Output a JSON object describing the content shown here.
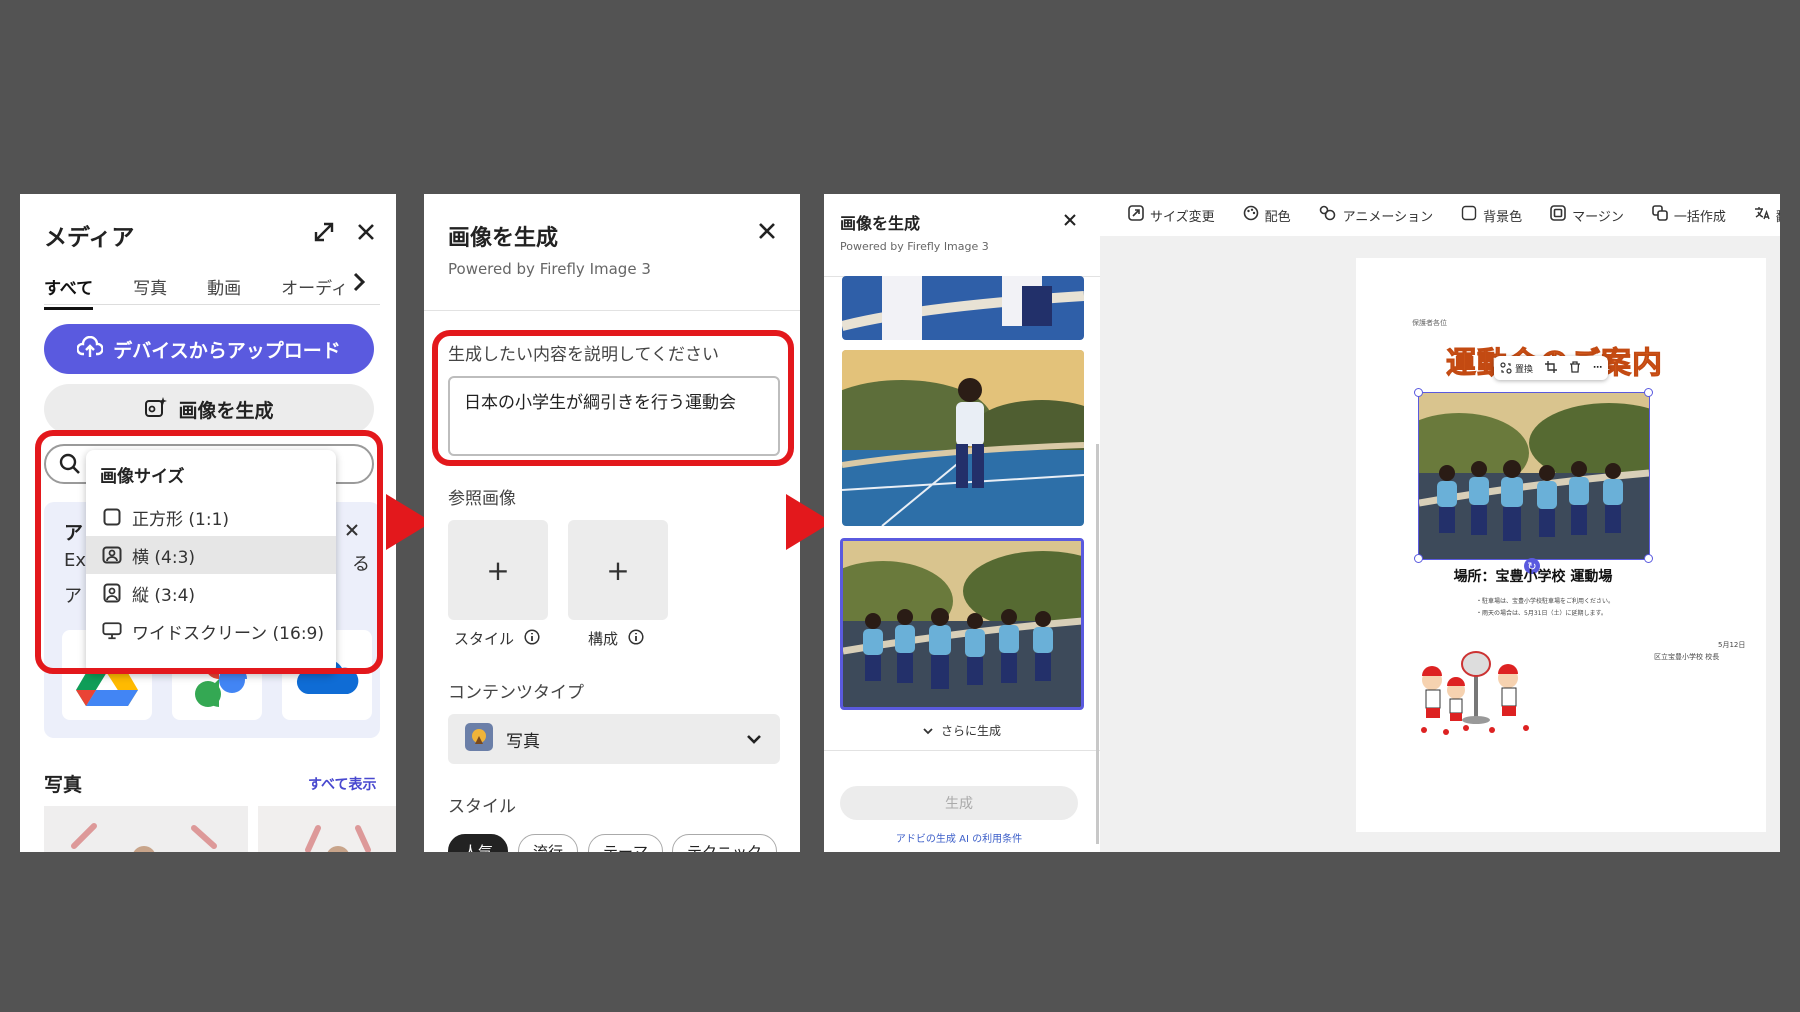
{
  "panel_media": {
    "title": "メディア",
    "tabs": [
      "すべて",
      "写真",
      "動画",
      "オーディ"
    ],
    "upload_label": "デバイスからアップロード",
    "generate_label": "画像を生成",
    "promo_fragments": [
      "ア",
      "Ex",
      "ア",
      "る"
    ],
    "dropdown": {
      "title": "画像サイズ",
      "items": [
        {
          "label": "正方形 (1:1)",
          "icon": "square-icon"
        },
        {
          "label": "横 (4:3)",
          "icon": "landscape-portrait-icon",
          "selected": true
        },
        {
          "label": "縦 (3:4)",
          "icon": "portrait-icon"
        },
        {
          "label": "ワイドスクリーン (16:9)",
          "icon": "monitor-icon"
        }
      ]
    },
    "photos_heading": "写真",
    "show_all": "すべて表示"
  },
  "panel_generate": {
    "title": "画像を生成",
    "powered_by": "Powered by Firefly Image 3",
    "prompt_label": "生成したい内容を説明してください",
    "prompt_value": "日本の小学生が綱引きを行う運動会",
    "reference_heading": "参照画像",
    "ref_style_label": "スタイル",
    "ref_composition_label": "構成",
    "content_type_heading": "コンテンツタイプ",
    "content_type_value": "写真",
    "style_heading": "スタイル",
    "style_chips": [
      "人気",
      "流行",
      "テーマ",
      "テクニック"
    ]
  },
  "panel_results": {
    "title": "画像を生成",
    "powered_by": "Powered by Firefly Image 3",
    "more_label": "さらに生成",
    "generate_button": "生成",
    "terms_link": "アドビの生成 AI の利用条件"
  },
  "editor": {
    "toolbar": [
      "サイズ変更",
      "配色",
      "アニメーション",
      "背景色",
      "マージン",
      "一括作成",
      "翻"
    ],
    "doc": {
      "header_small": "保護者各位",
      "title": "運動会のご案内",
      "image_toolbar_replace": "置換",
      "venue": "場所：宝豊小学校 運動場",
      "notes": [
        "・駐車場は、宝豊小学校駐車場をご利用ください。",
        "・雨天の場合は、5月31日（土）に延期します。"
      ],
      "date": "5月12日",
      "signature": "区立宝豊小学校 校長"
    }
  },
  "colors": {
    "accent": "#5a5adf",
    "highlight": "#e3181c",
    "title_orange": "#e8732f"
  }
}
